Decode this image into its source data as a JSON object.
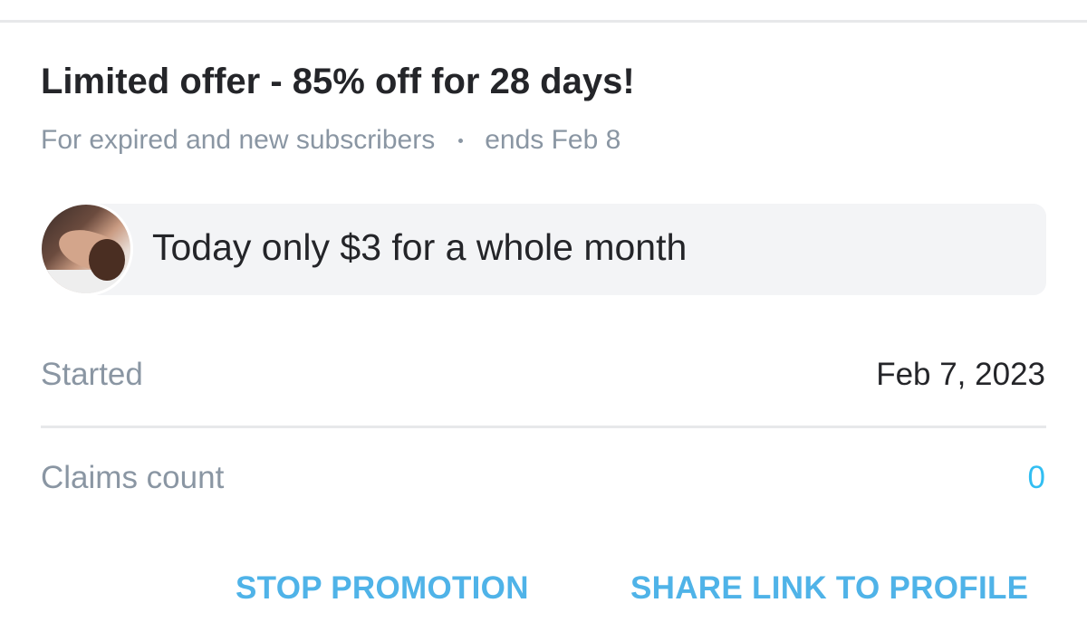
{
  "offer": {
    "title": "Limited offer - 85% off for 28 days!",
    "audience": "For expired and new subscribers",
    "separator": "•",
    "ends": "ends Feb 8"
  },
  "message": {
    "text": "Today only $3 for a whole month"
  },
  "details": {
    "started_label": "Started",
    "started_value": "Feb 7, 2023",
    "claims_label": "Claims count",
    "claims_value": "0"
  },
  "actions": {
    "stop_label": "STOP PROMOTION",
    "share_label": "SHARE LINK TO PROFILE"
  },
  "colors": {
    "accent": "#00aff0",
    "text": "#242529",
    "muted": "#8a96a3"
  }
}
